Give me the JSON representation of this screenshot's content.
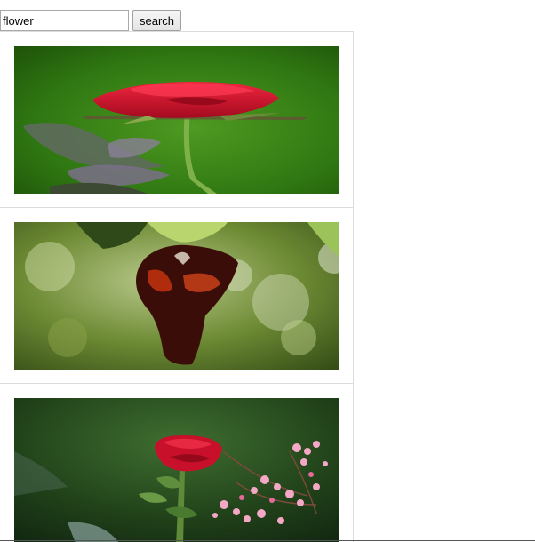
{
  "search": {
    "value": "flower",
    "button_label": "search"
  },
  "results": [
    {
      "image": "red-rose-photo"
    },
    {
      "image": "dark-red-wilted-flower-photo"
    },
    {
      "image": "red-rose-with-pink-flowers-photo"
    }
  ],
  "colors": {
    "rose_red": "#d4102e",
    "leaf_green": "#3a7a1c",
    "border": "#dcdcdc"
  }
}
